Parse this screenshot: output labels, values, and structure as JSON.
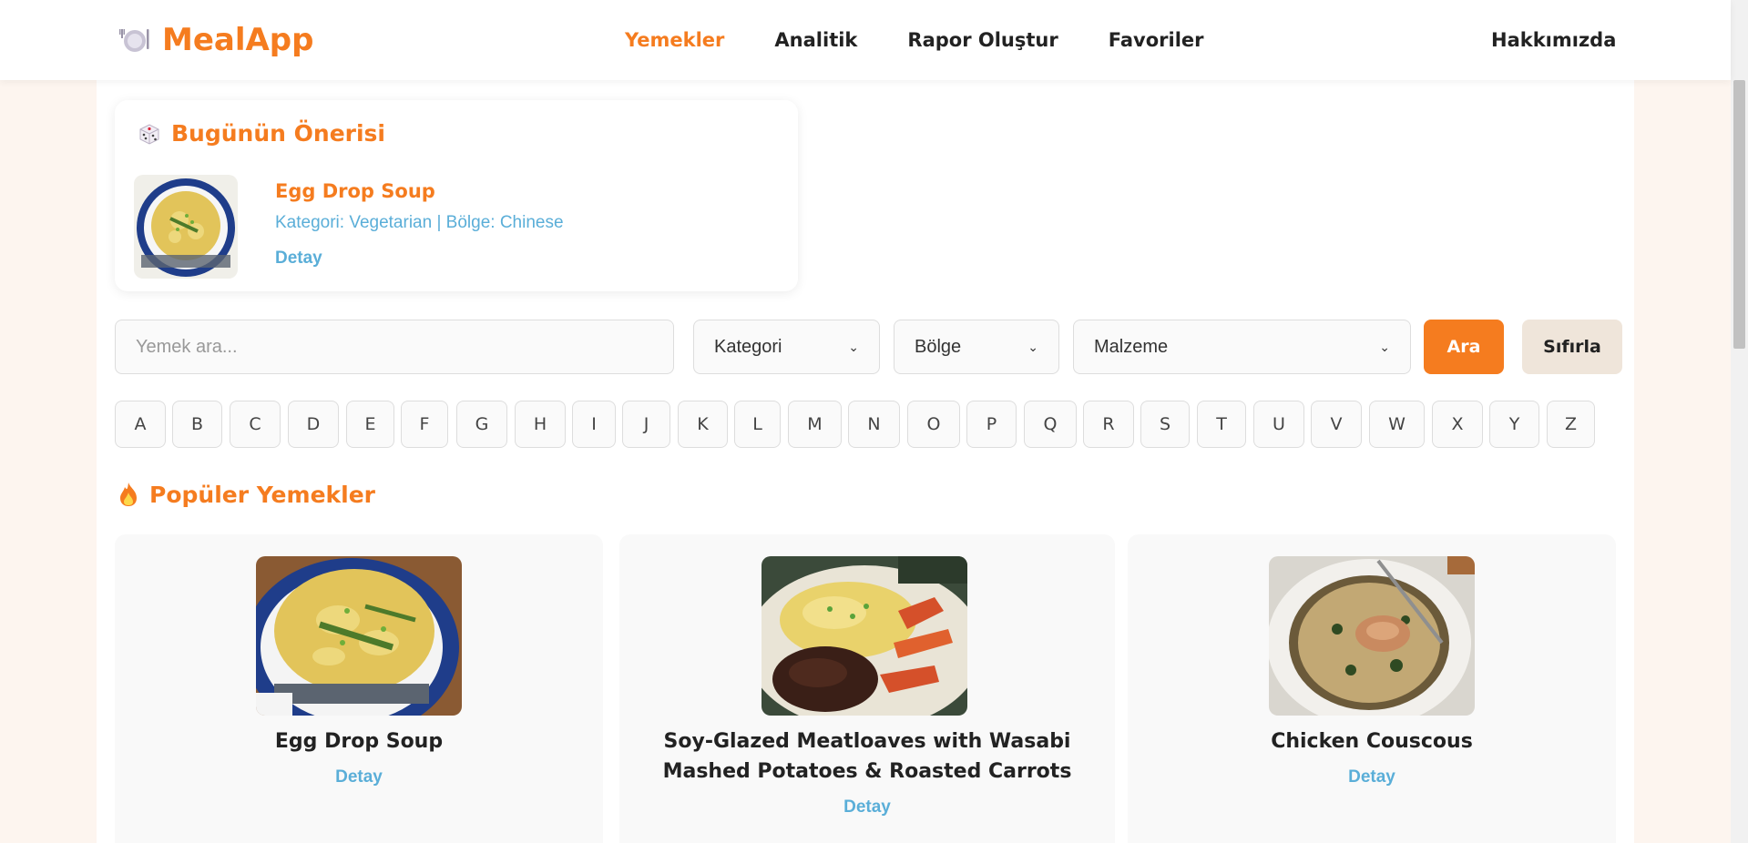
{
  "navbar": {
    "brand": "MealApp",
    "links": [
      "Yemekler",
      "Analitik",
      "Rapor Oluştur",
      "Favoriler"
    ],
    "about": "Hakkımızda"
  },
  "suggestion": {
    "title": "Bugünün Önerisi",
    "meal_name": "Egg Drop Soup",
    "meta": "Kategori: Vegetarian | Bölge: Chinese",
    "detail": "Detay"
  },
  "search": {
    "placeholder": "Yemek ara...",
    "category": "Kategori",
    "region": "Bölge",
    "ingredient": "Malzeme",
    "search_btn": "Ara",
    "reset_btn": "Sıfırla"
  },
  "letters": [
    "A",
    "B",
    "C",
    "D",
    "E",
    "F",
    "G",
    "H",
    "I",
    "J",
    "K",
    "L",
    "M",
    "N",
    "O",
    "P",
    "Q",
    "R",
    "S",
    "T",
    "U",
    "V",
    "W",
    "X",
    "Y",
    "Z"
  ],
  "popular": {
    "title": "Popüler Yemekler",
    "meals": [
      {
        "name": "Egg Drop Soup",
        "detail": "Detay"
      },
      {
        "name": "Soy-Glazed Meatloaves with Wasabi Mashed Potatoes & Roasted Carrots",
        "detail": "Detay"
      },
      {
        "name": "Chicken Couscous",
        "detail": "Detay"
      }
    ]
  },
  "colors": {
    "accent": "#f57c1f",
    "link": "#5aaed8",
    "reset_bg": "#efe5da",
    "page_bg": "#fdf5ef"
  }
}
